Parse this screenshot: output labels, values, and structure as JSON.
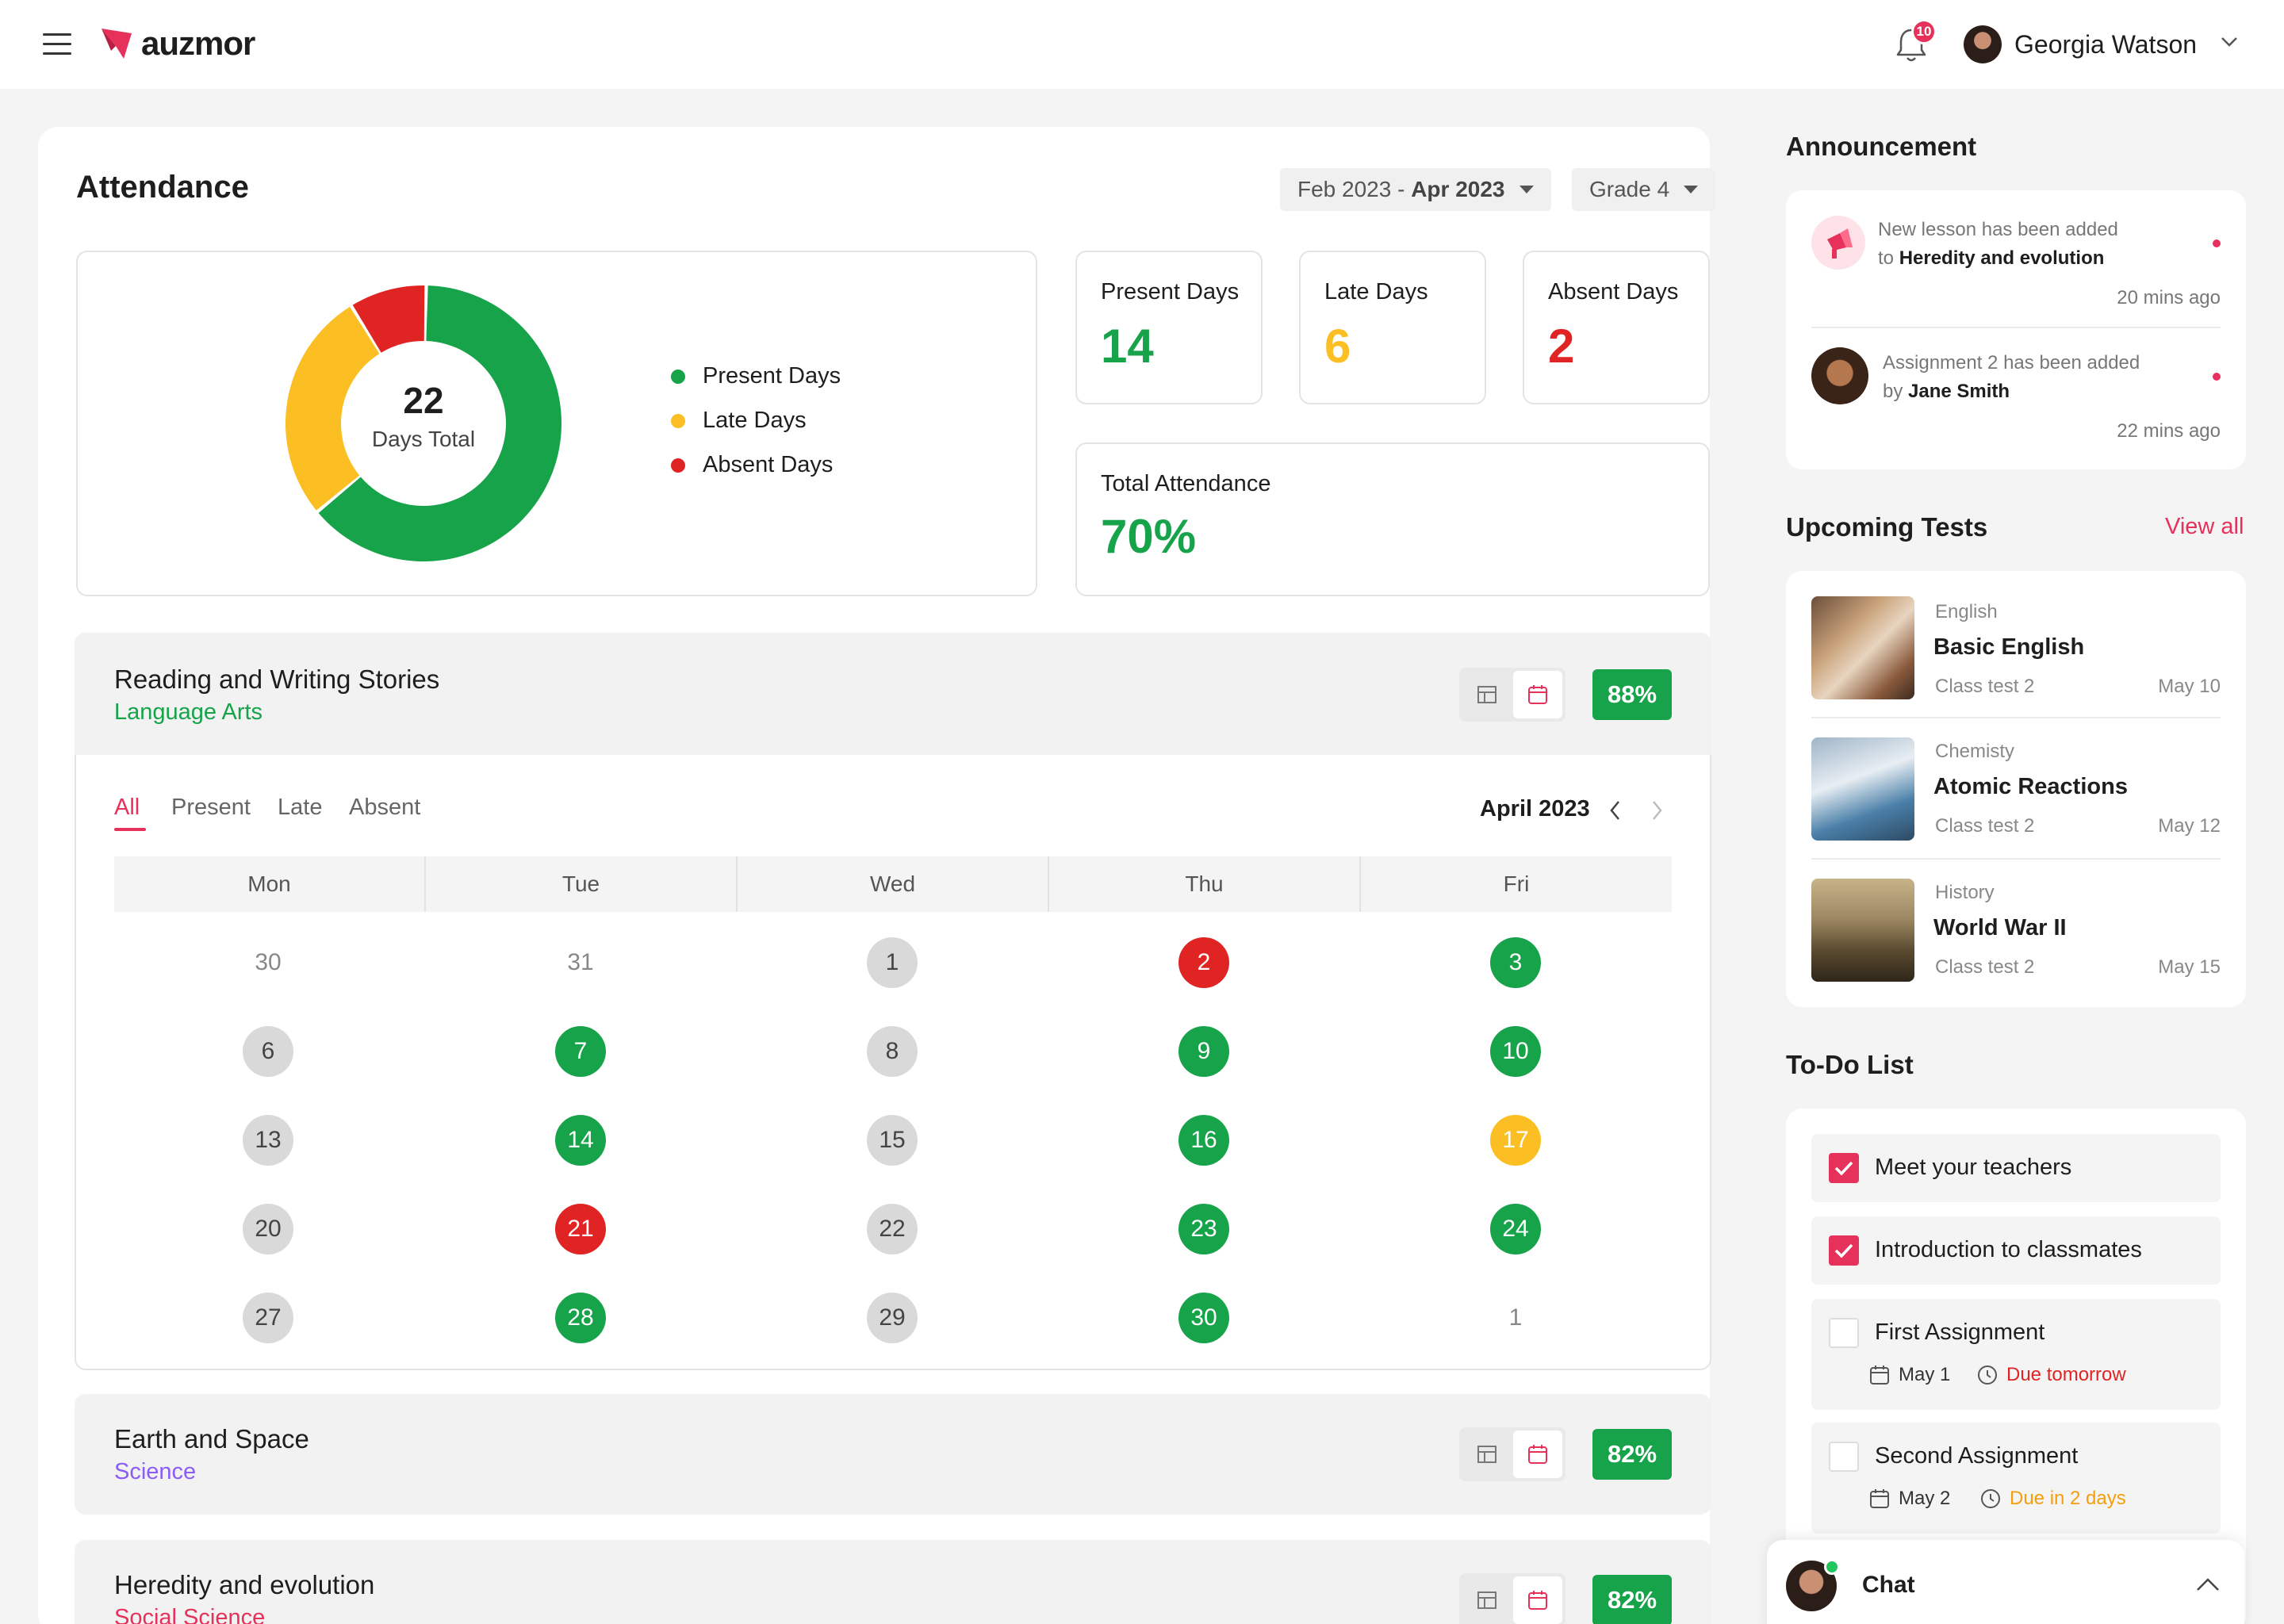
{
  "header": {
    "logo_text": "auzmor",
    "notifications_count": "10",
    "user_name": "Georgia Watson"
  },
  "attendance": {
    "title": "Attendance",
    "period_filter": {
      "label_start": "Feb 2023 - ",
      "label_end": "Apr 2023"
    },
    "grade_filter": "Grade 4",
    "donut": {
      "total": "22",
      "total_label": "Days Total",
      "segments": [
        {
          "name": "Present Days",
          "value": 14,
          "color": "#17a34a"
        },
        {
          "name": "Late Days",
          "value": 6,
          "color": "#fbbf24"
        },
        {
          "name": "Absent Days",
          "value": 2,
          "color": "#e02424"
        }
      ]
    },
    "stats": {
      "present_label": "Present Days",
      "present_value": "14",
      "late_label": "Late Days",
      "late_value": "6",
      "absent_label": "Absent Days",
      "absent_value": "2",
      "total_label": "Total Attendance",
      "total_value": "70%"
    }
  },
  "subjects": [
    {
      "title": "Reading and Writing Stories",
      "category": "Language Arts",
      "category_color": "#17a34a",
      "percent": "88%"
    },
    {
      "title": "Earth and Space",
      "category": "Science",
      "category_color": "#8b5cf6",
      "percent": "82%"
    },
    {
      "title": "Heredity and evolution",
      "category": "Social Science",
      "category_color": "#e6315b",
      "percent": "82%"
    }
  ],
  "calendar": {
    "tabs": [
      "All",
      "Present",
      "Late",
      "Absent"
    ],
    "active_tab": "All",
    "month": "April 2023",
    "weekdays": [
      "Mon",
      "Tue",
      "Wed",
      "Thu",
      "Fri"
    ],
    "weeks": [
      [
        {
          "d": "30",
          "s": "out"
        },
        {
          "d": "31",
          "s": "out"
        },
        {
          "d": "1",
          "s": "none"
        },
        {
          "d": "2",
          "s": "absent"
        },
        {
          "d": "3",
          "s": "present"
        }
      ],
      [
        {
          "d": "6",
          "s": "none"
        },
        {
          "d": "7",
          "s": "present"
        },
        {
          "d": "8",
          "s": "none"
        },
        {
          "d": "9",
          "s": "present"
        },
        {
          "d": "10",
          "s": "present"
        }
      ],
      [
        {
          "d": "13",
          "s": "none"
        },
        {
          "d": "14",
          "s": "present"
        },
        {
          "d": "15",
          "s": "none"
        },
        {
          "d": "16",
          "s": "present"
        },
        {
          "d": "17",
          "s": "late"
        }
      ],
      [
        {
          "d": "20",
          "s": "none"
        },
        {
          "d": "21",
          "s": "absent"
        },
        {
          "d": "22",
          "s": "none"
        },
        {
          "d": "23",
          "s": "present"
        },
        {
          "d": "24",
          "s": "present"
        }
      ],
      [
        {
          "d": "27",
          "s": "none"
        },
        {
          "d": "28",
          "s": "present"
        },
        {
          "d": "29",
          "s": "none"
        },
        {
          "d": "30",
          "s": "present"
        },
        {
          "d": "1",
          "s": "out"
        }
      ]
    ]
  },
  "announcement": {
    "title": "Announcement",
    "items": [
      {
        "line1": "New lesson has been added",
        "line2_prefix": "to ",
        "line2_bold": "Heredity and evolution",
        "time": "20 mins ago"
      },
      {
        "line1": "Assignment 2 has been added",
        "line2_prefix": "by ",
        "line2_bold": "Jane Smith",
        "time": "22 mins ago"
      }
    ]
  },
  "upcoming_tests": {
    "title": "Upcoming Tests",
    "view_all": "View all",
    "items": [
      {
        "category": "English",
        "name": "Basic English",
        "sub": "Class test 2",
        "date": "May 10"
      },
      {
        "category": "Chemisty",
        "name": "Atomic Reactions",
        "sub": "Class test 2",
        "date": "May 12"
      },
      {
        "category": "History",
        "name": "World War II",
        "sub": "Class test 2",
        "date": "May 15"
      }
    ]
  },
  "todo": {
    "title": "To-Do List",
    "items": [
      {
        "label": "Meet your teachers",
        "checked": true
      },
      {
        "label": "Introduction to classmates",
        "checked": true
      },
      {
        "label": "First Assignment",
        "checked": false,
        "date": "May 1",
        "due": "Due tomorrow",
        "due_color": "#e02424"
      },
      {
        "label": "Second Assignment",
        "checked": false,
        "date": "May 2",
        "due": "Due in 2 days",
        "due_color": "#f59e0b"
      }
    ]
  },
  "chat": {
    "label": "Chat"
  }
}
